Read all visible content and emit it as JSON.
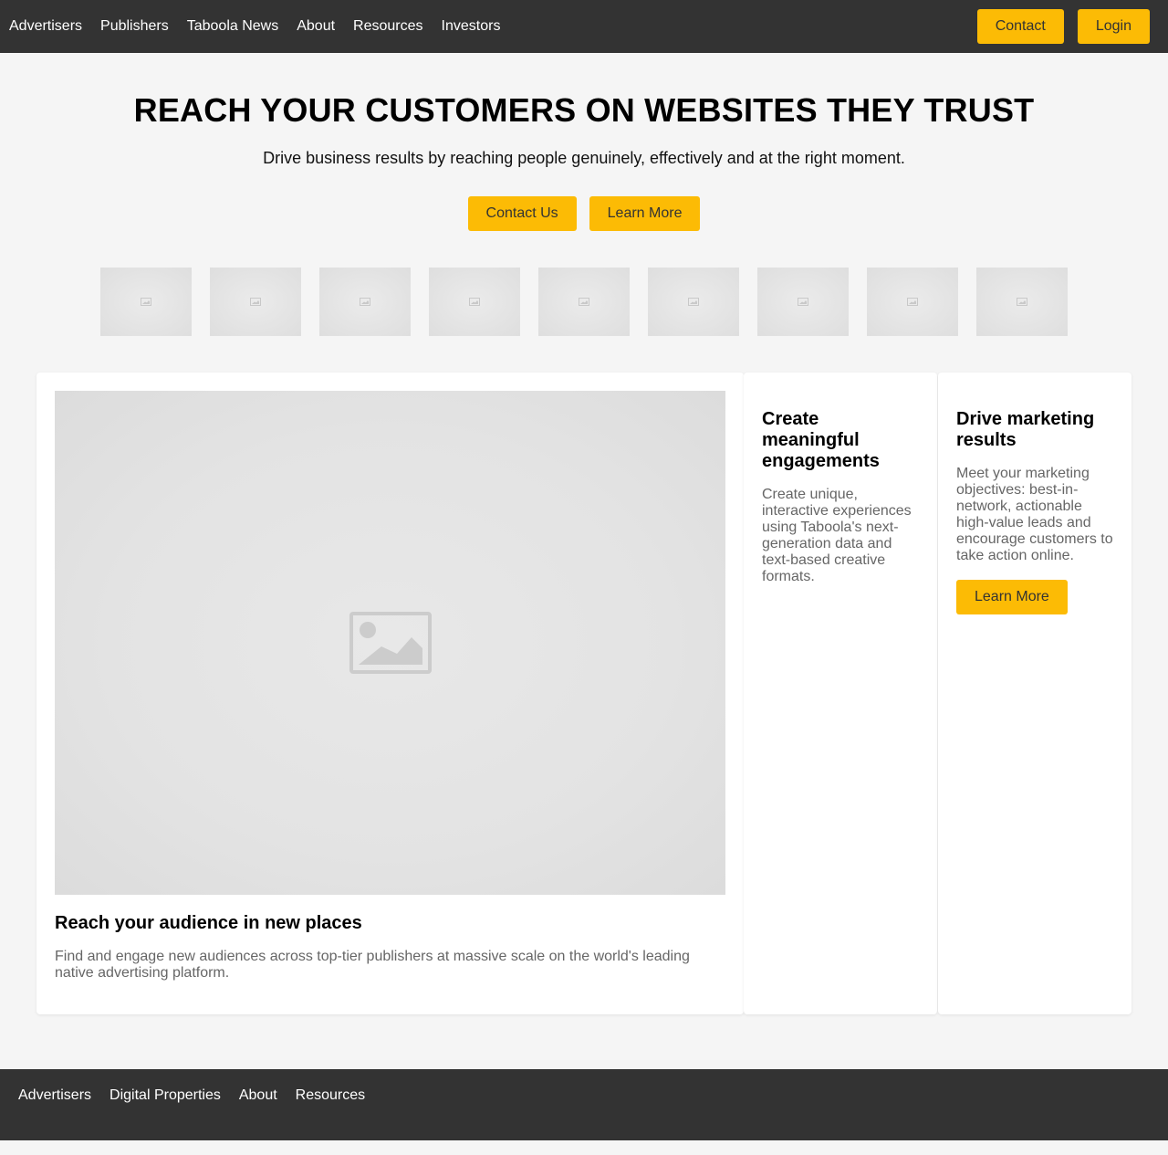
{
  "nav": {
    "links": [
      "Advertisers",
      "Publishers",
      "Taboola News",
      "About",
      "Resources",
      "Investors"
    ],
    "contact_label": "Contact",
    "login_label": "Login"
  },
  "hero": {
    "title": "REACH YOUR CUSTOMERS ON WEBSITES THEY TRUST",
    "subtitle": "Drive business results by reaching people genuinely, effectively and at the right moment.",
    "contact_us_label": "Contact Us",
    "learn_more_label": "Learn More"
  },
  "logos": {
    "icon": "image-placeholder-icon",
    "count": 9
  },
  "cards": {
    "main": {
      "image_icon": "image-placeholder-icon",
      "title": "Reach your audience in new places",
      "text": "Find and engage new audiences across top-tier publishers at massive scale on the world's leading native advertising platform."
    },
    "engagements": {
      "title": "Create meaningful engagements",
      "text": "Create unique, interactive experiences using Taboola's next-generation data and text-based creative formats."
    },
    "marketing": {
      "title": "Drive marketing results",
      "text": "Meet your marketing objectives: best-in-network, actionable high-value leads and encourage customers to take action online.",
      "learn_more_label": "Learn More"
    }
  },
  "footer": {
    "links": [
      "Advertisers",
      "Digital Properties",
      "About",
      "Resources"
    ]
  },
  "colors": {
    "nav_bg": "#333333",
    "accent": "#fcbb05",
    "page_bg": "#f5f5f5"
  }
}
